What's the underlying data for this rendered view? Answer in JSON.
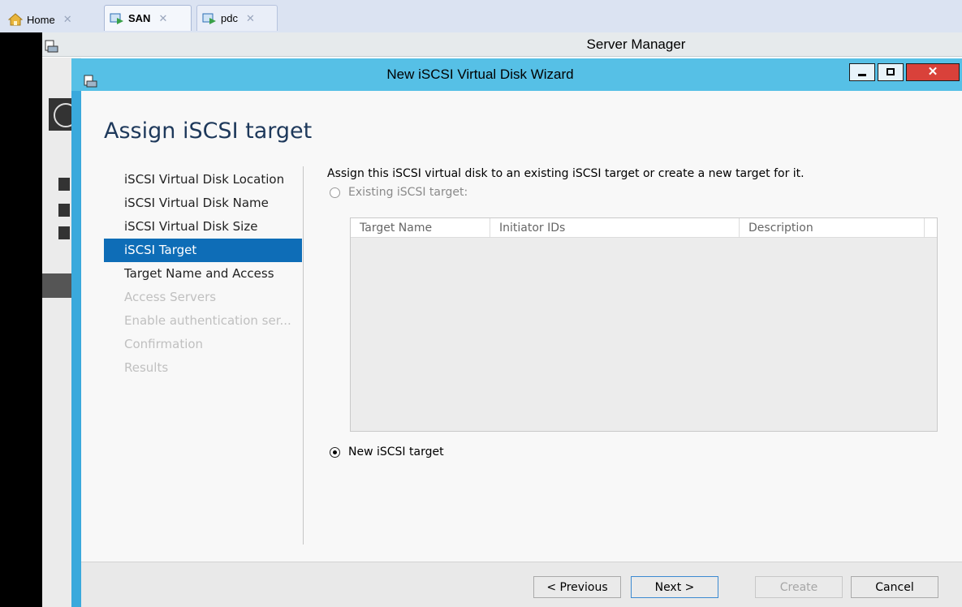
{
  "host_tabs": [
    {
      "label": "Home",
      "icon": "home-icon"
    },
    {
      "label": "SAN",
      "icon": "vm-icon"
    },
    {
      "label": "pdc",
      "icon": "vm-icon"
    }
  ],
  "server_manager": {
    "title": "Server Manager"
  },
  "wizard": {
    "title": "New iSCSI Virtual Disk Wizard",
    "heading": "Assign iSCSI target",
    "steps": [
      {
        "label": "iSCSI Virtual Disk Location",
        "state": "done"
      },
      {
        "label": "iSCSI Virtual Disk Name",
        "state": "done"
      },
      {
        "label": "iSCSI Virtual Disk Size",
        "state": "done"
      },
      {
        "label": "iSCSI Target",
        "state": "current"
      },
      {
        "label": "Target Name and Access",
        "state": "enabled"
      },
      {
        "label": "Access Servers",
        "state": "disabled"
      },
      {
        "label": "Enable authentication ser...",
        "state": "disabled"
      },
      {
        "label": "Confirmation",
        "state": "disabled"
      },
      {
        "label": "Results",
        "state": "disabled"
      }
    ],
    "description": "Assign this iSCSI virtual disk to an existing iSCSI target or create a new target for it.",
    "existing_option": {
      "label": "Existing iSCSI target:",
      "selected": false,
      "enabled": false
    },
    "grid_columns": [
      "Target Name",
      "Initiator IDs",
      "Description"
    ],
    "new_option": {
      "label": "New iSCSI target",
      "selected": true
    },
    "buttons": {
      "previous": "< Previous",
      "next": "Next >",
      "create": "Create",
      "cancel": "Cancel"
    }
  },
  "colors": {
    "title_bar": "#56c0e6",
    "selected_step": "#0e6db7",
    "heading": "#1e395b",
    "close_button": "#d9413a"
  }
}
